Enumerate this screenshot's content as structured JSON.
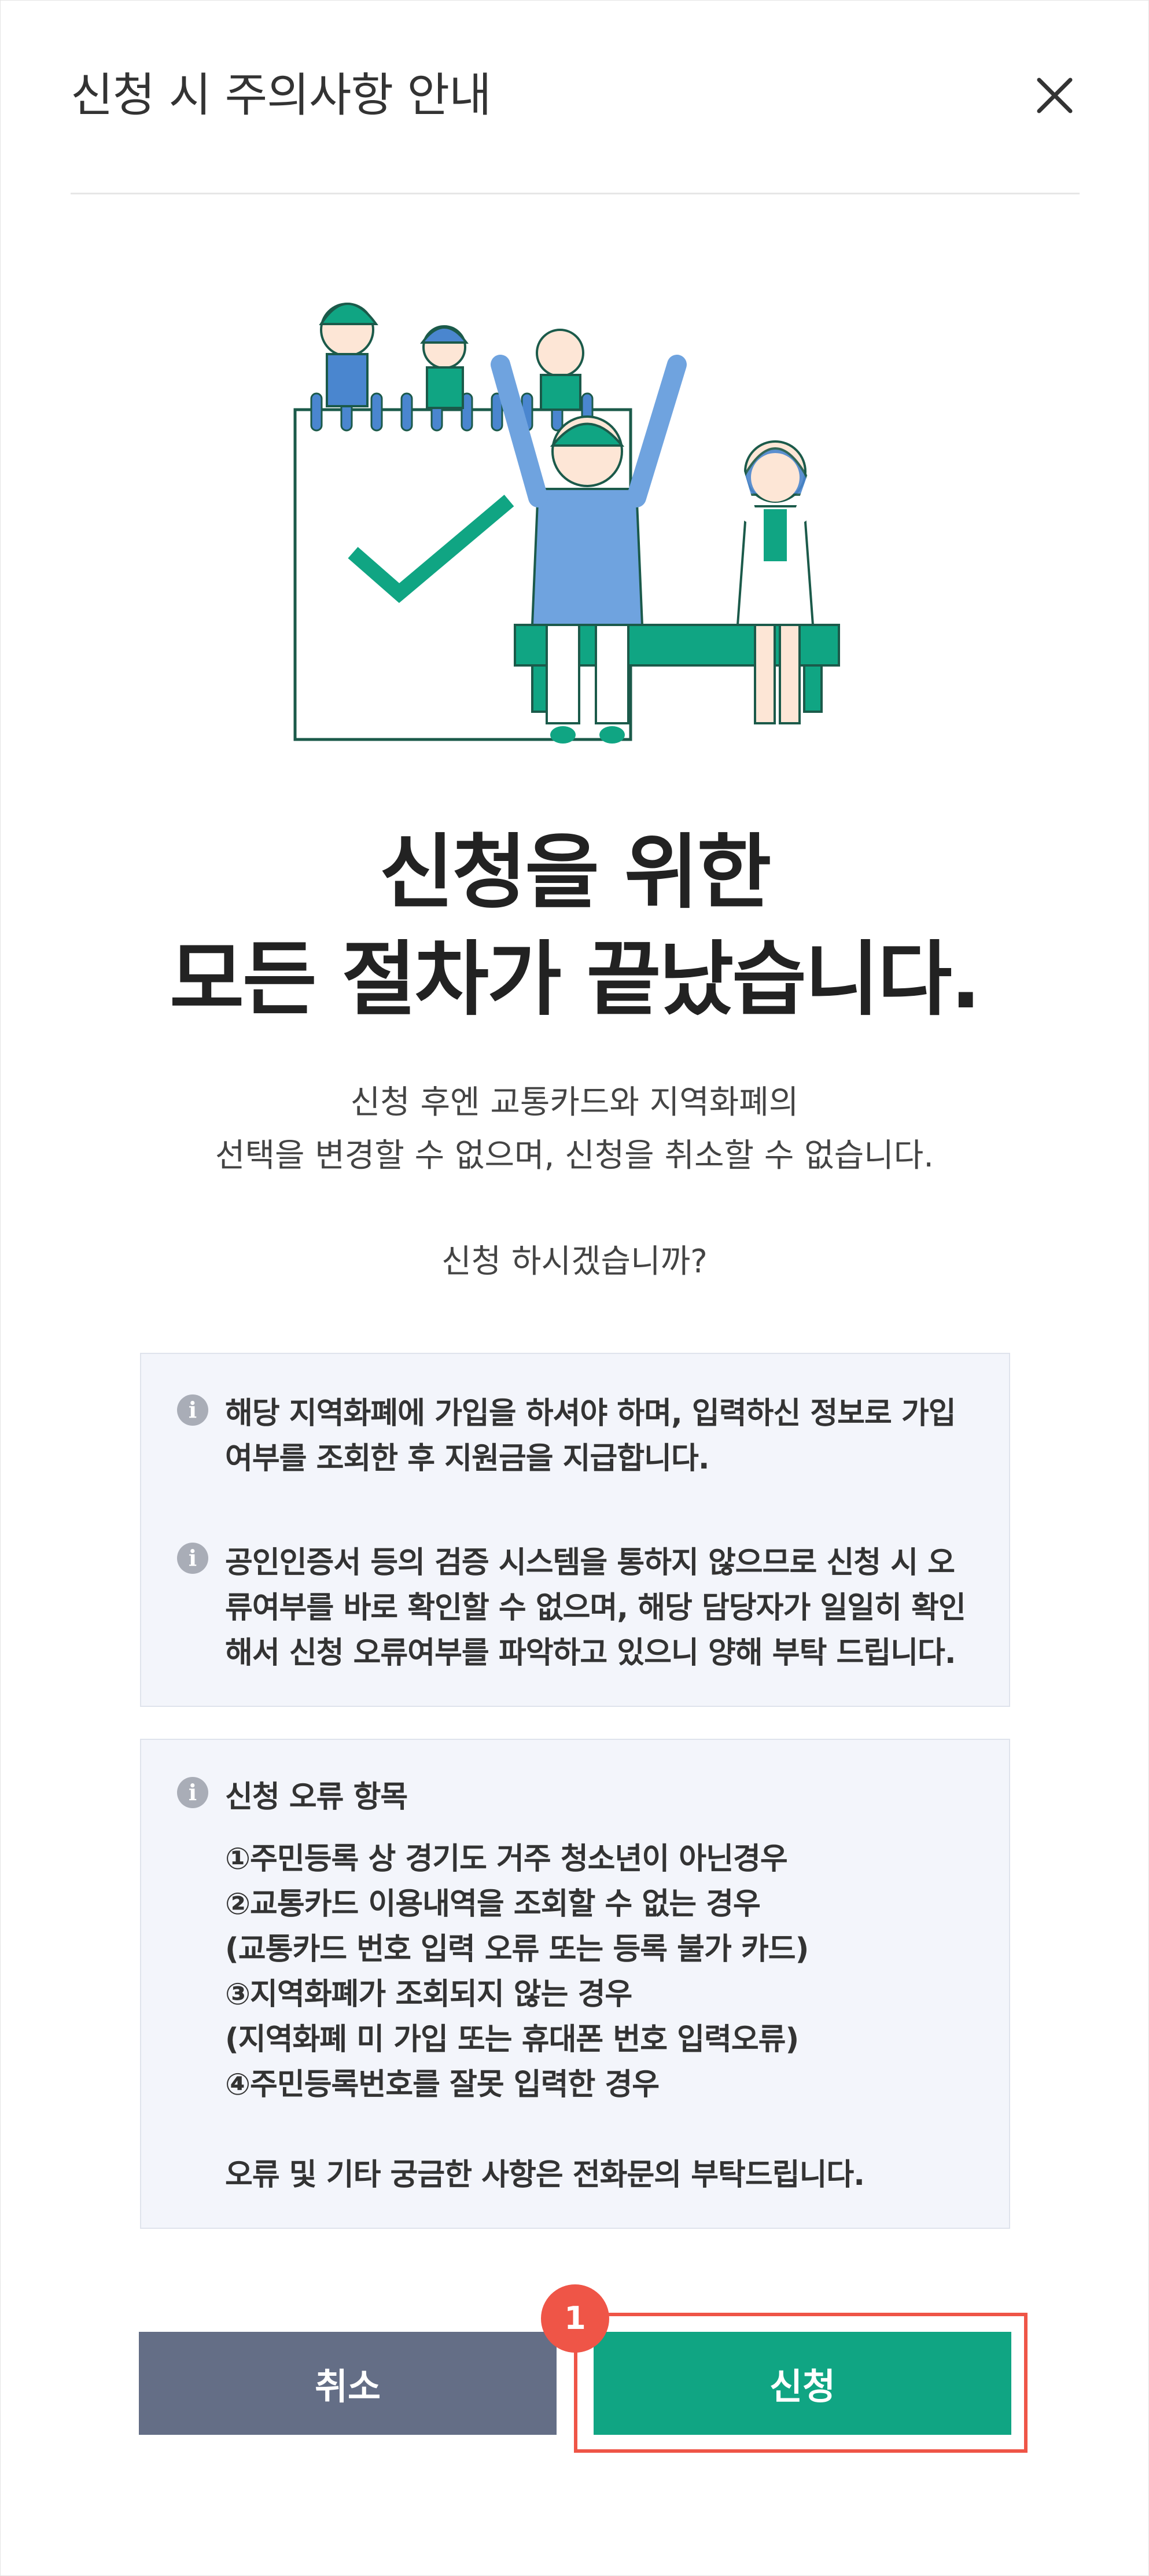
{
  "header": {
    "title": "신청 시 주의사항 안내",
    "close_icon": "close-icon"
  },
  "headline": {
    "line1": "신청을 위한",
    "line2": "모든 절차가 끝났습니다."
  },
  "description": {
    "line1": "신청 후엔 교통카드와 지역화폐의",
    "line2": "선택을 변경할 수 없으며, 신청을 취소할 수 없습니다.",
    "question": "신청 하시겠습니까?"
  },
  "notice_box_1": {
    "item1": [
      "해당 지역화폐에 가입을 하셔야 하며, 입력하신 정보로 가입",
      "여부를 조회한 후 지원금을 지급합니다."
    ],
    "item2": [
      "공인인증서 등의 검증 시스템을 통하지 않으므로 신청 시 오",
      "류여부를 바로 확인할 수 없으며, 해당 담당자가 일일히 확인",
      "해서 신청 오류여부를 파악하고 있으니 양해 부탁 드립니다."
    ]
  },
  "notice_box_2": {
    "title": "신청 오류 항목",
    "lines": [
      "①주민등록 상 경기도 거주 청소년이 아닌경우",
      "②교통카드 이용내역을 조회할 수 없는 경우",
      "(교통카드 번호 입력 오류 또는 등록 불가 카드)",
      "③지역화폐가 조회되지 않는 경우",
      "(지역화폐 미 가입 또는 휴대폰 번호 입력오류)",
      "④주민등록번호를 잘못 입력한 경우"
    ],
    "footer": "오류 및 기타 궁금한 사항은 전화문의 부탁드립니다."
  },
  "info_icon_glyph": "i",
  "buttons": {
    "cancel": "취소",
    "apply": "신청"
  },
  "annotation": {
    "badge": "1"
  },
  "colors": {
    "accent_green": "#10a583",
    "cancel_gray": "#646e86",
    "highlight_red": "#ef5547",
    "box_bg": "#f3f5fb"
  }
}
